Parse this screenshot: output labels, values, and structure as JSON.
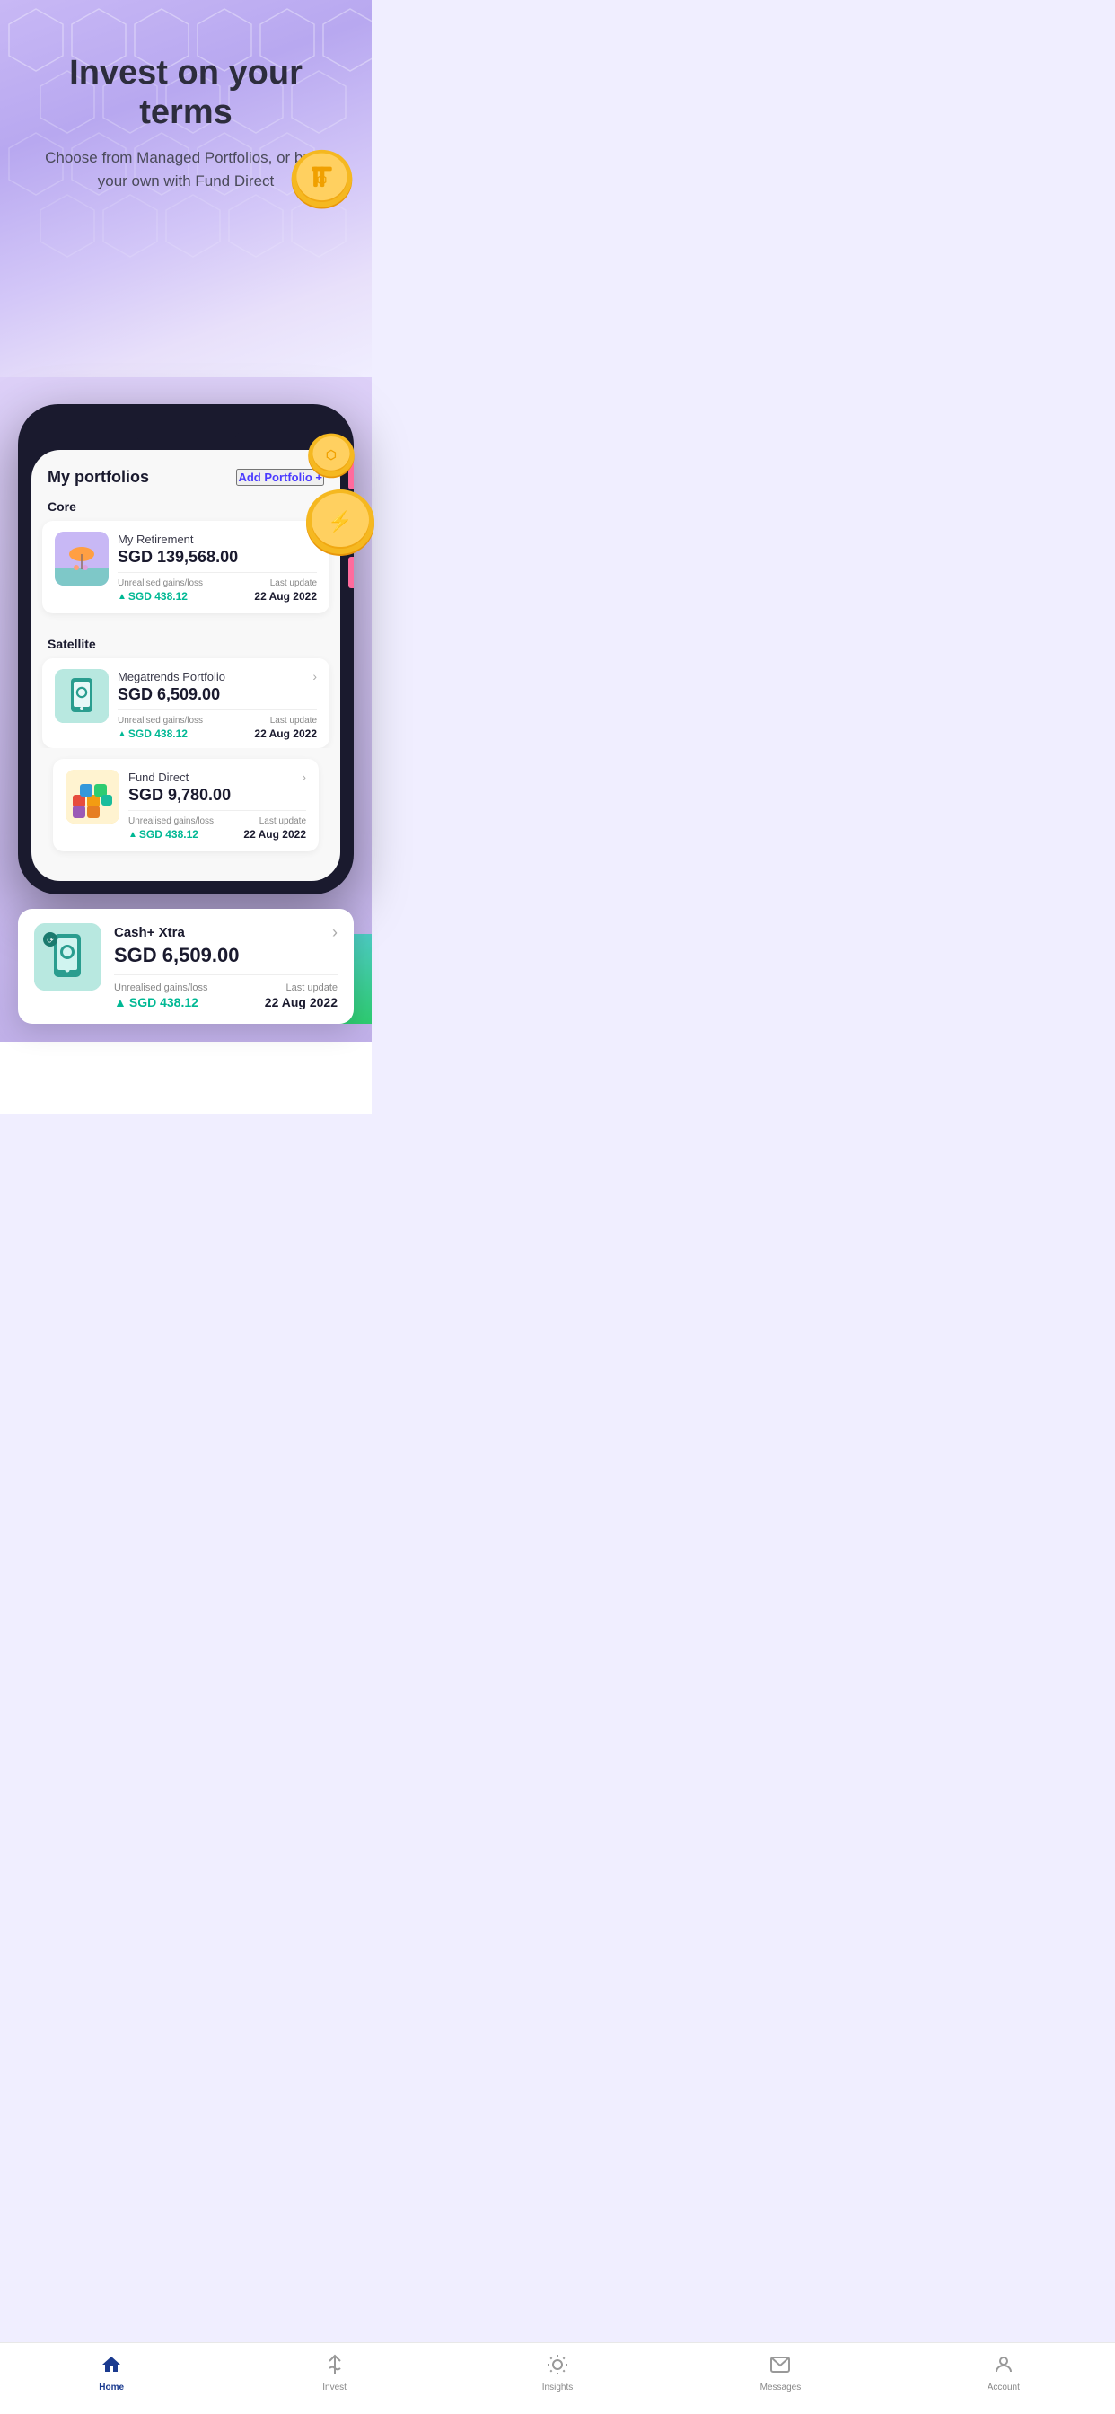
{
  "hero": {
    "title": "Invest on your terms",
    "subtitle": "Choose from Managed Portfolios, or build your own with Fund Direct"
  },
  "portfolio_screen": {
    "title": "My portfolios",
    "add_button": "Add Portfolio +",
    "sections": [
      {
        "label": "Core",
        "portfolios": [
          {
            "name": "My Retirement",
            "amount": "SGD 139,568.00",
            "gains_label": "Unrealised gains/loss",
            "gains_value": "SGD 438.12",
            "update_label": "Last update",
            "update_value": "22 Aug 2022",
            "type": "retirement"
          }
        ]
      },
      {
        "label": "Satellite",
        "portfolios": [
          {
            "name": "Megatrends Portfolio",
            "amount": "SGD 6,509.00",
            "gains_label": "Unrealised gains/loss",
            "gains_value": "SGD 438.12",
            "update_label": "Last update",
            "update_value": "22 Aug 2022",
            "type": "megatrends"
          }
        ]
      }
    ]
  },
  "floating_card": {
    "name": "Cash+ Xtra",
    "amount": "SGD 6,509.00",
    "gains_label": "Unrealised gains/loss",
    "gains_value": "SGD 438.12",
    "update_label": "Last update",
    "update_value": "22 Aug 2022"
  },
  "fund_direct": {
    "name": "Fund Direct",
    "amount": "SGD 9,780.00",
    "gains_label": "Unrealised gains/loss",
    "gains_value": "SGD 438.12",
    "update_label": "Last update",
    "update_value": "22 Aug 2022"
  },
  "bottom_nav": {
    "items": [
      {
        "label": "Home",
        "icon": "🏠",
        "active": true
      },
      {
        "label": "Invest",
        "icon": "◇",
        "active": false
      },
      {
        "label": "Insights",
        "icon": "💡",
        "active": false
      },
      {
        "label": "Messages",
        "icon": "✉",
        "active": false
      },
      {
        "label": "Account",
        "icon": "👤",
        "active": false
      }
    ]
  }
}
